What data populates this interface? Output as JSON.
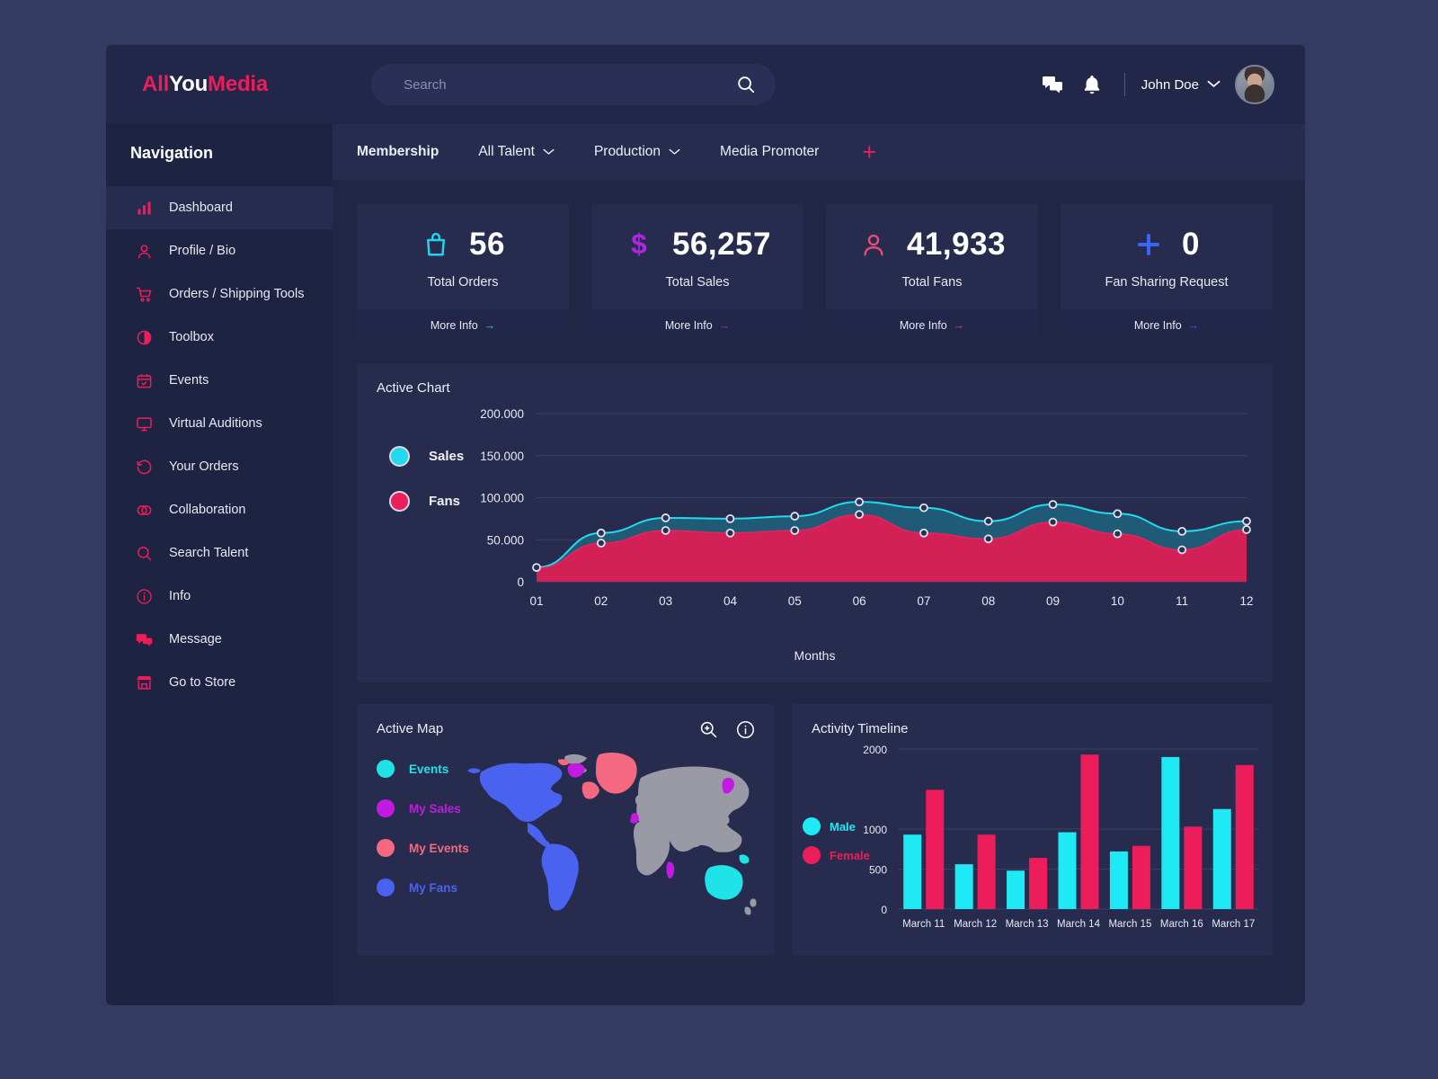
{
  "brand": {
    "part1": "All",
    "part2": "You",
    "part3": "Media"
  },
  "search": {
    "placeholder": "Search",
    "value": "",
    "icon": "search-icon"
  },
  "header": {
    "message_icon": "chat-icon",
    "bell_icon": "bell-icon",
    "user_name": "John Doe",
    "chevron_icon": "chevron-down-icon",
    "avatar": "user-avatar"
  },
  "sidebar": {
    "title": "Navigation",
    "items": [
      {
        "label": "Dashboard",
        "icon": "bar-chart-icon",
        "active": true
      },
      {
        "label": "Profile / Bio",
        "icon": "user-icon",
        "active": false
      },
      {
        "label": "Orders / Shipping Tools",
        "icon": "shopping-cart-icon",
        "active": false
      },
      {
        "label": "Toolbox",
        "icon": "contrast-circle-icon",
        "active": false
      },
      {
        "label": "Events",
        "icon": "calendar-icon",
        "active": false
      },
      {
        "label": "Virtual Auditions",
        "icon": "monitor-icon",
        "active": false
      },
      {
        "label": "Your Orders",
        "icon": "history-icon",
        "active": false
      },
      {
        "label": "Collaboration",
        "icon": "handshake-icon",
        "active": false
      },
      {
        "label": "Search Talent",
        "icon": "search-icon",
        "active": false
      },
      {
        "label": "Info",
        "icon": "info-circle-icon",
        "active": false
      },
      {
        "label": "Message",
        "icon": "comment-icon",
        "active": false
      },
      {
        "label": "Go to Store",
        "icon": "store-icon",
        "active": false
      }
    ]
  },
  "tabs": [
    {
      "label": "Membership",
      "dropdown": false,
      "bold": true
    },
    {
      "label": "All Talent",
      "dropdown": true,
      "bold": false
    },
    {
      "label": "Production",
      "dropdown": true,
      "bold": false
    },
    {
      "label": "Media Promoter",
      "dropdown": false,
      "bold": false
    }
  ],
  "add_tab": {
    "icon": "plus-icon",
    "label": "+"
  },
  "stats": [
    {
      "value": "56",
      "label": "Total Orders",
      "icon": "shopping-bag-icon",
      "color": "#22d3ee",
      "more": "More Info",
      "arrow": "→"
    },
    {
      "value": "56,257",
      "label": "Total Sales",
      "icon": "dollar-icon",
      "color": "#b025e0",
      "more": "More Info",
      "arrow": "→"
    },
    {
      "value": "41,933",
      "label": "Total Fans",
      "icon": "user-icon",
      "color": "#ec4a77",
      "more": "More Info",
      "arrow": "→"
    },
    {
      "value": "0",
      "label": "Fan Sharing Request",
      "icon": "plus-icon",
      "color": "#3b63f6",
      "more": "More Info",
      "arrow": "→"
    }
  ],
  "active_chart": {
    "title": "Active Chart",
    "legend": [
      {
        "label": "Sales",
        "color": "#22d9ee"
      },
      {
        "label": "Fans",
        "color": "#ec1d5a"
      }
    ]
  },
  "active_map": {
    "title": "Active Map",
    "zoom_icon": "zoom-in-icon",
    "info_icon": "info-circle-icon",
    "legend": [
      {
        "label": "Events",
        "color": "#1fe3e8"
      },
      {
        "label": "My Sales",
        "color": "#c21ae0"
      },
      {
        "label": "My Events",
        "color": "#f4697f"
      },
      {
        "label": "My Fans",
        "color": "#4a62f0"
      }
    ],
    "base_color": "#9a9aa6"
  },
  "activity_timeline": {
    "title": "Activity Timeline"
  },
  "chart_data": [
    {
      "type": "area",
      "title": "Active Chart",
      "xlabel": "Months",
      "ylabel": "",
      "categories": [
        "01",
        "02",
        "03",
        "04",
        "05",
        "06",
        "07",
        "08",
        "09",
        "10",
        "11",
        "12"
      ],
      "yticks": [
        "0",
        "50.000",
        "100.000",
        "150.000",
        "200.000"
      ],
      "ylim": [
        0,
        200000
      ],
      "grid": true,
      "legend_position": "left",
      "series": [
        {
          "name": "Sales",
          "color": "#22d9ee",
          "values": [
            17000,
            58000,
            76000,
            75000,
            78000,
            95000,
            88000,
            72000,
            92000,
            81000,
            60000,
            72000
          ]
        },
        {
          "name": "Fans",
          "color": "#ec1d5a",
          "values": [
            16000,
            46000,
            61000,
            58000,
            61000,
            80000,
            58000,
            51000,
            71000,
            57000,
            38000,
            62000
          ]
        }
      ]
    },
    {
      "type": "bar",
      "title": "Activity Timeline",
      "xlabel": "",
      "ylabel": "",
      "categories": [
        "March 11",
        "March 12",
        "March 13",
        "March 14",
        "March 15",
        "March 16",
        "March 17"
      ],
      "yticks": [
        "0",
        "500",
        "1000",
        "2000"
      ],
      "ylim": [
        0,
        2000
      ],
      "grid": true,
      "legend_position": "left",
      "series": [
        {
          "name": "Male",
          "color": "#1fe9f5",
          "values": [
            930,
            560,
            480,
            960,
            720,
            1900,
            1250
          ]
        },
        {
          "name": "Female",
          "color": "#ec1d5a",
          "values": [
            1490,
            930,
            640,
            1930,
            790,
            1030,
            1800
          ]
        }
      ]
    }
  ]
}
